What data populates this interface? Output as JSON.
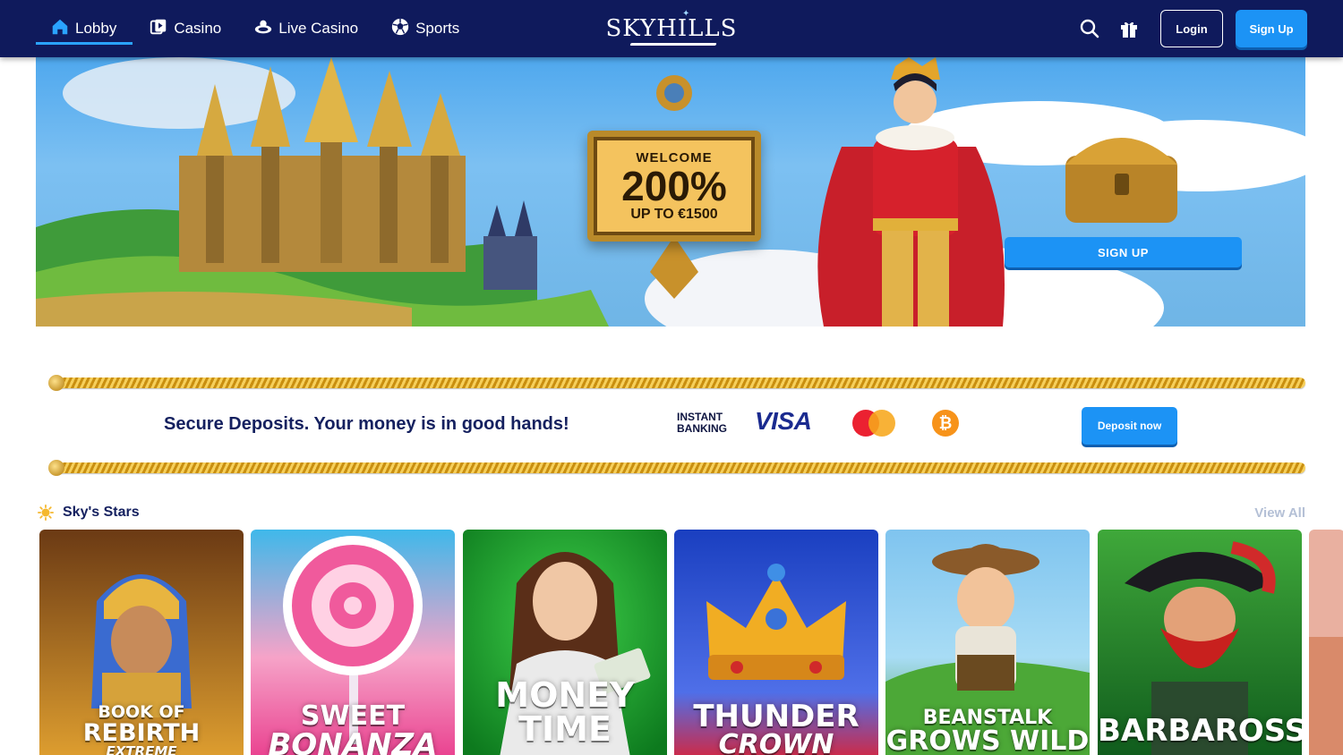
{
  "colors": {
    "nav_bg": "#0f1a5c",
    "accent": "#1c93f5",
    "heading": "#14205f",
    "muted": "#b4c0d6"
  },
  "nav": {
    "items": [
      {
        "label": "Lobby",
        "icon": "home-icon",
        "active": true
      },
      {
        "label": "Casino",
        "icon": "cards-play-icon",
        "active": false
      },
      {
        "label": "Live Casino",
        "icon": "live-dealer-icon",
        "active": false
      },
      {
        "label": "Sports",
        "icon": "soccer-ball-icon",
        "active": false
      }
    ]
  },
  "brand": {
    "logo_text": "SKYHILLS"
  },
  "header": {
    "login_label": "Login",
    "signup_label": "Sign Up",
    "search_icon": "search-icon",
    "gift_icon": "gift-icon"
  },
  "hero": {
    "welcome": "WELCOME",
    "percent": "200%",
    "amount": "UP TO €1500",
    "cta_label": "SIGN UP"
  },
  "deposits": {
    "text": "Secure Deposits. Your money is in good hands!",
    "instant_line1": "INSTANT",
    "instant_line2": "BANKING",
    "visa": "VISA",
    "btc_symbol": "₿",
    "button_label": "Deposit now"
  },
  "games_section": {
    "title": "Sky's Stars",
    "view_all": "View All",
    "games": [
      {
        "title_line1": "BOOK OF",
        "title_line2": "REBIRTH",
        "title_line3": "EXTREME"
      },
      {
        "title_line1": "SWEET",
        "title_line2": "BONANZA",
        "title_line3": ""
      },
      {
        "title_line1": "MONEY TIME",
        "title_line2": "",
        "title_line3": ""
      },
      {
        "title_line1": "THUNDER",
        "title_line2": "CROWN",
        "title_line3": ""
      },
      {
        "title_line1": "BEANSTALK",
        "title_line2": "GROWS WILD",
        "title_line3": ""
      },
      {
        "title_line1": "BARBAROSSA",
        "title_line2": "",
        "title_line3": ""
      }
    ]
  }
}
